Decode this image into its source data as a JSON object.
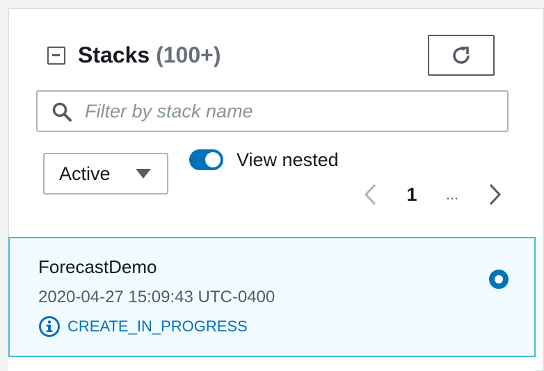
{
  "header": {
    "title": "Stacks",
    "count": "(100+)"
  },
  "search": {
    "placeholder": "Filter by stack name"
  },
  "status_filter": {
    "selected": "Active"
  },
  "view_nested": {
    "label": "View nested",
    "enabled": true
  },
  "pagination": {
    "current_page": "1",
    "ellipsis": "..."
  },
  "stacks": [
    {
      "name": "ForecastDemo",
      "created": "2020-04-27 15:09:43 UTC-0400",
      "status": "CREATE_IN_PROGRESS",
      "selected": true
    }
  ],
  "colors": {
    "accent": "#0073bb",
    "selected_bg": "#f1faff",
    "selected_border": "#44b9d6",
    "text": "#16191f",
    "muted": "#687078"
  },
  "icons": [
    "collapse-icon",
    "refresh-icon",
    "search-icon",
    "caret-down-icon",
    "chevron-left-icon",
    "chevron-right-icon",
    "info-icon"
  ]
}
